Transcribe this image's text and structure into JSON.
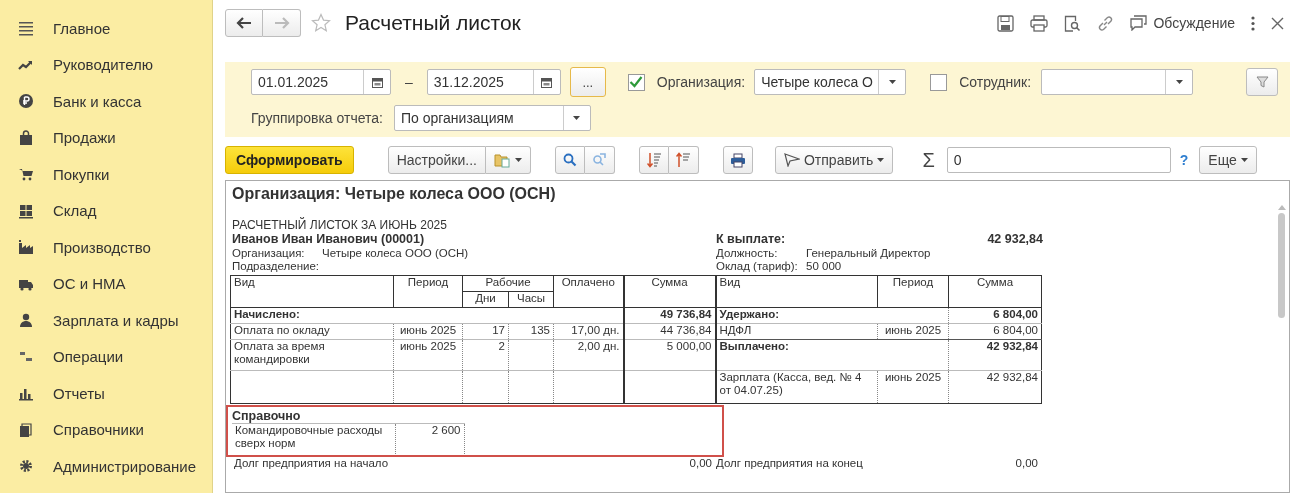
{
  "sidebar": {
    "items": [
      {
        "label": "Главное"
      },
      {
        "label": "Руководителю"
      },
      {
        "label": "Банк и касса"
      },
      {
        "label": "Продажи"
      },
      {
        "label": "Покупки"
      },
      {
        "label": "Склад"
      },
      {
        "label": "Производство"
      },
      {
        "label": "ОС и НМА"
      },
      {
        "label": "Зарплата и кадры"
      },
      {
        "label": "Операции"
      },
      {
        "label": "Отчеты"
      },
      {
        "label": "Справочники"
      },
      {
        "label": "Администрирование"
      }
    ]
  },
  "header": {
    "title": "Расчетный листок",
    "discussion": "Обсуждение"
  },
  "filters": {
    "date_from": "01.01.2025",
    "separator": "–",
    "date_to": "31.12.2025",
    "period_button": "...",
    "organization": {
      "checked": true,
      "label": "Организация:",
      "value": "Четыре колеса О"
    },
    "employee": {
      "checked": false,
      "label": "Сотрудник:"
    },
    "grouping": {
      "label": "Группировка отчета:",
      "value": "По организациям"
    }
  },
  "toolbar": {
    "generate": "Сформировать",
    "settings": "Настройки...",
    "send": "Отправить",
    "sum_symbol": "Σ",
    "sum_value": "0",
    "help": "?",
    "more": "Еще"
  },
  "report": {
    "heading": "Организация: Четыре колеса ООО (ОСН)",
    "sheet_title": "РАСЧЕТНЫЙ ЛИСТОК ЗА ИЮНЬ 2025",
    "employee": "Иванов Иван Иванович (00001)",
    "to_pay": {
      "label": "К выплате:",
      "value": "42 932,84"
    },
    "details_left": [
      {
        "label": "Организация:",
        "value": "Четыре колеса ООО (ОСН)"
      },
      {
        "label": "Подразделение:"
      }
    ],
    "details_right": [
      {
        "label": "Должность:",
        "value": "Генеральный Директор"
      },
      {
        "label": "Оклад (тариф):",
        "value": "50 000"
      }
    ],
    "left_columns": {
      "type": "Вид",
      "period": "Период",
      "work": "Рабочие",
      "days": "Дни",
      "hours": "Часы",
      "paid": "Оплачено",
      "amount": "Сумма"
    },
    "right_columns": {
      "type": "Вид",
      "period": "Период",
      "amount": "Сумма"
    },
    "rows": [
      {
        "left": {
          "kind": "total",
          "label": "Начислено:",
          "amount": "49 736,84"
        },
        "right": {
          "kind": "total",
          "label": "Удержано:",
          "amount": "6 804,00"
        }
      },
      {
        "left": {
          "kind": "line",
          "name": "Оплата по окладу",
          "period": "июнь 2025",
          "days": "17",
          "hours": "135",
          "paid": "17,00 дн.",
          "amount": "44 736,84"
        },
        "right": {
          "kind": "line",
          "name": "НДФЛ",
          "period": "июнь 2025",
          "amount": "6 804,00"
        }
      },
      {
        "left": {
          "kind": "line",
          "name": "Оплата за время командировки",
          "period": "июнь 2025",
          "days": "2",
          "paid": "2,00 дн.",
          "amount": "5 000,00"
        },
        "right": {
          "kind": "total",
          "label": "Выплачено:",
          "amount": "42 932,84"
        }
      },
      {
        "left": {
          "kind": "blank"
        },
        "right": {
          "kind": "line",
          "name": "Зарплата (Касса, вед. № 4 от 04.07.25)",
          "period": "июнь 2025",
          "amount": "42 932,84"
        }
      }
    ],
    "reference": {
      "title": "Справочно",
      "items": [
        {
          "name": "Командировочные расходы сверх норм",
          "amount": "2 600"
        }
      ]
    },
    "debt": {
      "start_label": "Долг предприятия на начало",
      "start_value": "0,00",
      "end_label": "Долг предприятия на конец",
      "end_value": "0,00"
    }
  }
}
